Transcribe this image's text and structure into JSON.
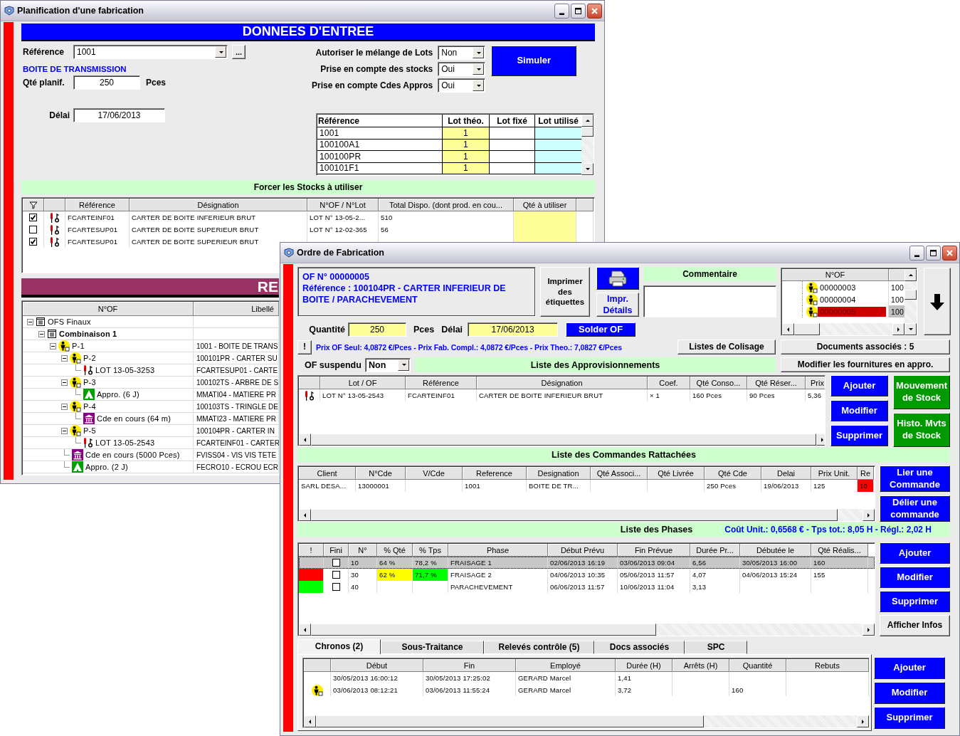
{
  "plan_window": {
    "title": "Planification d'une fabrication",
    "banner": "DONNEES D'ENTREE",
    "reference": {
      "label": "Référence",
      "value": "1001",
      "browse_button": "..."
    },
    "reference_name": "BOITE DE TRANSMISSION",
    "quantity": {
      "label": "Qté planif.",
      "value": "250",
      "unit": "Pces"
    },
    "delay": {
      "label": "Délai",
      "value": "17/06/2013"
    },
    "options": [
      {
        "label": "Autoriser le mélange de Lots",
        "value": "Non"
      },
      {
        "label": "Prise en compte des stocks",
        "value": "Oui"
      },
      {
        "label": "Prise en compte Cdes Appros",
        "value": "Oui"
      }
    ],
    "simulate_button": "Simuler",
    "lots_table": {
      "columns": [
        "Référence",
        "Lot théo.",
        "Lot fixé",
        "Lot utilisé"
      ],
      "rows": [
        [
          "1001",
          "1",
          null,
          null
        ],
        [
          "100100A1",
          "1",
          null,
          null
        ],
        [
          "100100PR",
          "1",
          null,
          null
        ],
        [
          "100101F1",
          "1",
          null,
          null
        ]
      ]
    },
    "stocks_title": "Forcer les Stocks à utiliser",
    "stocks_table": {
      "columns": [
        "Référence",
        "Désignation",
        "N°OF / N°Lot",
        "Total Dispo. (dont prod. en cou...",
        "Qté à utiliser"
      ],
      "rows": [
        {
          "checked": true,
          "cells": [
            "FCARTEINF01",
            "CARTER DE BOITE INFERIEUR BRUT",
            "LOT N° 13-05-2...",
            "510"
          ]
        },
        {
          "checked": false,
          "cells": [
            "FCARTESUP01",
            "CARTER DE BOITE SUPERIEUR BRUT",
            "LOT N° 12-02-365",
            "56"
          ]
        },
        {
          "checked": true,
          "cells": [
            "FCARTESUP01",
            "CARTER DE BOITE SUPERIEUR BRUT"
          ]
        }
      ]
    },
    "results_banner": "RE",
    "tree": {
      "columns": [
        "N°OF",
        "Libellé"
      ],
      "nodes": [
        {
          "kind": "list",
          "label": "OFS Finaux",
          "expanded": true,
          "children": [
            {
              "kind": "combination",
              "label": "Combinaison 1",
              "expanded": true,
              "children": [
                {
                  "kind": "of",
                  "label": "P-1",
                  "libelle": "1001 - BOITE DE TRANS",
                  "expanded": true,
                  "children": [
                    {
                      "kind": "of",
                      "label": "P-2",
                      "libelle": "100101PR - CARTER SU",
                      "expanded": true,
                      "children": [
                        {
                          "kind": "lot",
                          "label": "LOT 13-05-3253",
                          "libelle": "FCARTESUP01 - CARTE"
                        }
                      ]
                    },
                    {
                      "kind": "of",
                      "label": "P-3",
                      "libelle": "100102TS - ARBRE DE S",
                      "expanded": true,
                      "children": [
                        {
                          "kind": "appro",
                          "label": "Appro. (6 J)",
                          "libelle": "MMATI04 - MATIERE PR"
                        }
                      ]
                    },
                    {
                      "kind": "of",
                      "label": "P-4",
                      "libelle": "100103TS - TRINGLE DE",
                      "expanded": true,
                      "children": [
                        {
                          "kind": "order",
                          "label": "Cde en cours (64 m)",
                          "libelle": "MMATI23 - MATIERE PR"
                        }
                      ]
                    },
                    {
                      "kind": "of",
                      "label": "P-5",
                      "libelle": "100104PR - CARTER IN",
                      "expanded": true,
                      "children": [
                        {
                          "kind": "lot",
                          "label": "LOT 13-05-2543",
                          "libelle": "FCARTEINF01 - CARTER"
                        }
                      ]
                    },
                    {
                      "kind": "order",
                      "label": "Cde en cours (5000 Pces)",
                      "libelle": "FVISS04 - VIS VIS TETE"
                    },
                    {
                      "kind": "appro",
                      "label": "Appro. (2 J)",
                      "libelle": "FECRO10 - ECROU ECR"
                    }
                  ]
                }
              ]
            }
          ]
        }
      ]
    }
  },
  "of_window": {
    "title": "Ordre de Fabrication",
    "header_lines": [
      "OF N° 00000005",
      "Référence : 100104PR - CARTER INFERIEUR DE BOITE / PARACHEVEMENT"
    ],
    "print_labels_button": "Imprimer des étiquettes",
    "print_details_button": "Impr. Détails",
    "comment_label": "Commentaire",
    "of_list": {
      "columns": [
        "N°OF"
      ],
      "rows": [
        {
          "number": "00000003",
          "value": "100",
          "selected": false
        },
        {
          "number": "00000004",
          "value": "100",
          "selected": false
        },
        {
          "number": "00000005",
          "value": "100",
          "selected": true
        }
      ]
    },
    "quantity": {
      "label": "Quantité",
      "value": "250",
      "unit": "Pces"
    },
    "delay": {
      "label": "Délai",
      "value": "17/06/2013"
    },
    "solder_button": "Solder OF",
    "alert_button": "!",
    "price_info": "Prix OF Seul: 4,0872 €/Pces - Prix Fab. Compl.: 4,0872 €/Pces - Prix Theo.: 7,0827 €/Pces",
    "colisage_button": "Listes de Colisage",
    "documents_button": "Documents associés : 5",
    "suspended": {
      "label": "OF suspendu",
      "value": "Non"
    },
    "appro_title": "Liste des Approvisionnements",
    "modify_supplies_button": "Modifier les fournitures en appro.",
    "appro_table": {
      "columns": [
        "Lot / OF",
        "Référence",
        "Désignation",
        "Coef.",
        "Qté Conso...",
        "Qté Réser...",
        "Prix"
      ],
      "rows": [
        {
          "cells": [
            "LOT N° 13-05-2543",
            "FCARTEINF01",
            "CARTER DE BOITE INFERIEUR BRUT",
            "× 1",
            "160 Pces",
            "90 Pces",
            "5,36"
          ]
        }
      ]
    },
    "appro_buttons": [
      "Ajouter",
      "Modifier",
      "Supprimer"
    ],
    "stock_buttons": [
      "Mouvement de Stock",
      "Histo. Mvts de Stock"
    ],
    "orders_title": "Liste des Commandes Rattachées",
    "orders_table": {
      "columns": [
        "Client",
        "N°Cde",
        "V/Cde",
        "Reference",
        "Designation",
        "Qté Associ...",
        "Qté Livrée",
        "Qté Cde",
        "Delai",
        "Prix Unit.",
        "Re"
      ],
      "rows": [
        {
          "cells": [
            "SARL DESA...",
            "13000001",
            null,
            "1001",
            "BOITE DE TR...",
            null,
            null,
            "250 Pces",
            "19/06/2013",
            "125",
            {
              "text": "10",
              "color": "#ff0000"
            }
          ]
        }
      ]
    },
    "orders_buttons": [
      "Lier une Commande",
      "Délier une commande"
    ],
    "phases_title": "Liste des Phases",
    "phases_summary": "Coût Unit.: 0,6568 € - Tps tot.: 8,05 H - Régl.: 2,02 H",
    "phases_table": {
      "columns": [
        "!",
        "Fini",
        "N°",
        "% Qté",
        "% Tps",
        "Phase",
        "Début Prévu",
        "Fin Prévue",
        "Durée Pr...",
        "Débutée le",
        "Qté Réalis..."
      ],
      "rows": [
        {
          "selected": true,
          "cells": [
            null,
            {
              "checked": false
            },
            "10",
            "64 %",
            "78,2 %",
            "FRAISAGE 1",
            "02/06/2013 16:19",
            "03/06/2013 09:04",
            "6,56",
            "30/05/2013 16:00",
            "160"
          ]
        },
        {
          "selected": false,
          "cells": [
            {
              "color": "#ff0000"
            },
            {
              "checked": false
            },
            "30",
            {
              "text": "62 %",
              "color": "#ffff00"
            },
            {
              "text": "71,7 %",
              "color": "#00ff00"
            },
            "FRAISAGE 2",
            "04/06/2013 10:35",
            "05/06/2013 11:57",
            "4,07",
            "04/06/2013 15:24",
            "155"
          ]
        },
        {
          "selected": false,
          "cells": [
            {
              "color": "#00ff00"
            },
            {
              "checked": false
            },
            "40",
            null,
            null,
            "PARACHEVEMENT",
            "06/06/2013 11:57",
            "10/06/2013 11:04",
            "3,13",
            null,
            null
          ]
        }
      ]
    },
    "phases_buttons": [
      "Ajouter",
      "Modifier",
      "Supprimer"
    ],
    "info_button": "Afficher Infos",
    "tabs": [
      {
        "label": "Chronos (2)",
        "selected": true
      },
      {
        "label": "Sous-Traitance",
        "selected": false
      },
      {
        "label": "Relevés contrôle (5)",
        "selected": false
      },
      {
        "label": "Docs associés",
        "selected": false
      },
      {
        "label": "SPC",
        "selected": false
      }
    ],
    "chronos_table": {
      "columns": [
        "Début",
        "Fin",
        "Employé",
        "Durée (H)",
        "Arrêts (H)",
        "Quantité",
        "Rebuts"
      ],
      "rows": [
        {
          "kind": "plain",
          "cells": [
            "30/05/2013 16:00:12",
            "30/05/2013 17:25:02",
            "GERARD Marcel",
            "1,41",
            null,
            null,
            null
          ]
        },
        {
          "kind": "operator",
          "cells": [
            "03/06/2013 08:12:21",
            "03/06/2013 11:55:24",
            "GERARD Marcel",
            "3,72",
            null,
            "160",
            null
          ]
        }
      ]
    },
    "chronos_buttons": [
      "Ajouter",
      "Modifier",
      "Supprimer"
    ]
  }
}
